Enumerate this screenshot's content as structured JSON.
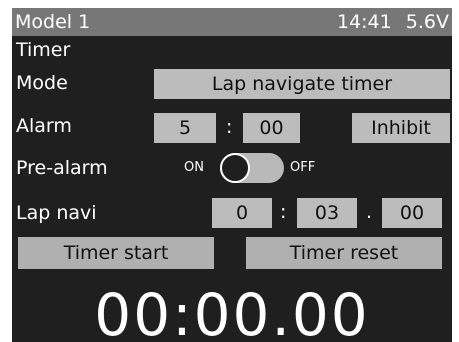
{
  "status": {
    "model": "Model 1",
    "time": "14:41",
    "voltage": "5.6V"
  },
  "screen": {
    "title": "Timer"
  },
  "mode": {
    "label": "Mode",
    "value": "Lap navigate timer"
  },
  "alarm": {
    "label": "Alarm",
    "minutes": "5",
    "separator": ":",
    "seconds": "00",
    "inhibit_label": "Inhibit"
  },
  "prealarm": {
    "label": "Pre-alarm",
    "on_label": "ON",
    "off_label": "OFF",
    "state": "ON"
  },
  "lapnavi": {
    "label": "Lap navi",
    "hours": "0",
    "separator1": ":",
    "minutes": "03",
    "separator2": ".",
    "seconds": "00"
  },
  "actions": {
    "start_label": "Timer start",
    "reset_label": "Timer reset"
  },
  "timer": {
    "display": "00:00.00"
  },
  "colors": {
    "background": "#1f1f1f",
    "status_bar": "#777777",
    "field": "#bcbcbc",
    "text": "#ffffff"
  }
}
